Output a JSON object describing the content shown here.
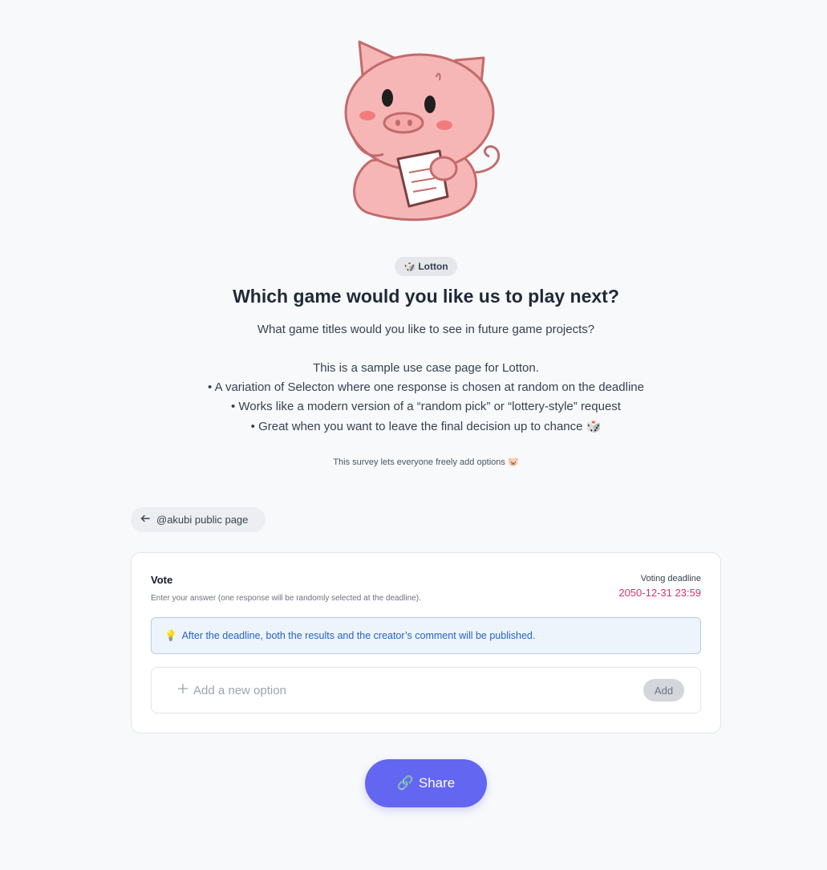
{
  "badge": {
    "icon": "🎲",
    "label": "Lotton"
  },
  "title": "Which game would you like us to play next?",
  "description": {
    "line1": "What game titles would you like to see in future game projects?",
    "line2": "This is a sample use case page for Lotton.",
    "bullet1": "• A variation of Selecton where one response is chosen at random on the deadline",
    "bullet2": "• Works like a modern version of a “random pick” or “lottery-style” request",
    "bullet3": "• Great when you want to leave the final decision up to chance 🎲"
  },
  "note": "This survey lets everyone freely add options 🐷",
  "back_link": {
    "label": "@akubi public page"
  },
  "vote": {
    "title": "Vote",
    "subtitle": "Enter your answer (one response will be randomly selected at the deadline).",
    "deadline_label": "Voting deadline",
    "deadline_value": "2050-12-31 23:59",
    "info": "After the deadline, both the results and the creator’s comment will be published.",
    "add_placeholder": "Add a new option",
    "add_button": "Add"
  },
  "share": {
    "icon": "🔗",
    "label": "Share"
  },
  "colors": {
    "accent": "#6366f1",
    "deadline": "#d6336c",
    "info": "#2563c9"
  }
}
